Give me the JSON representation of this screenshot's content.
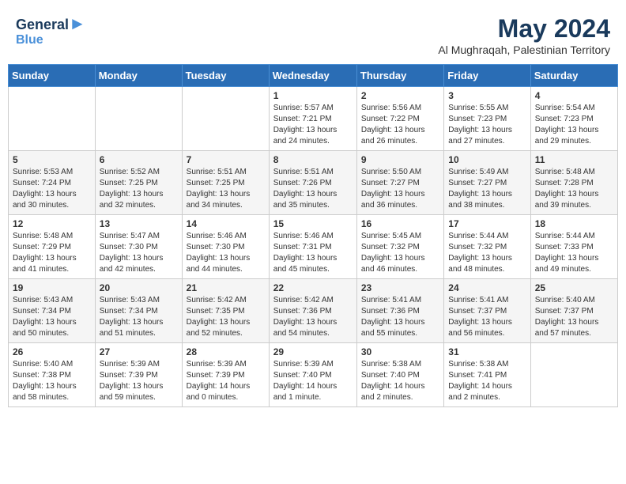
{
  "header": {
    "logo_line1": "General",
    "logo_line2": "Blue",
    "month": "May 2024",
    "location": "Al Mughraqah, Palestinian Territory"
  },
  "weekdays": [
    "Sunday",
    "Monday",
    "Tuesday",
    "Wednesday",
    "Thursday",
    "Friday",
    "Saturday"
  ],
  "weeks": [
    [
      {
        "day": "",
        "info": ""
      },
      {
        "day": "",
        "info": ""
      },
      {
        "day": "",
        "info": ""
      },
      {
        "day": "1",
        "info": "Sunrise: 5:57 AM\nSunset: 7:21 PM\nDaylight: 13 hours\nand 24 minutes."
      },
      {
        "day": "2",
        "info": "Sunrise: 5:56 AM\nSunset: 7:22 PM\nDaylight: 13 hours\nand 26 minutes."
      },
      {
        "day": "3",
        "info": "Sunrise: 5:55 AM\nSunset: 7:23 PM\nDaylight: 13 hours\nand 27 minutes."
      },
      {
        "day": "4",
        "info": "Sunrise: 5:54 AM\nSunset: 7:23 PM\nDaylight: 13 hours\nand 29 minutes."
      }
    ],
    [
      {
        "day": "5",
        "info": "Sunrise: 5:53 AM\nSunset: 7:24 PM\nDaylight: 13 hours\nand 30 minutes."
      },
      {
        "day": "6",
        "info": "Sunrise: 5:52 AM\nSunset: 7:25 PM\nDaylight: 13 hours\nand 32 minutes."
      },
      {
        "day": "7",
        "info": "Sunrise: 5:51 AM\nSunset: 7:25 PM\nDaylight: 13 hours\nand 34 minutes."
      },
      {
        "day": "8",
        "info": "Sunrise: 5:51 AM\nSunset: 7:26 PM\nDaylight: 13 hours\nand 35 minutes."
      },
      {
        "day": "9",
        "info": "Sunrise: 5:50 AM\nSunset: 7:27 PM\nDaylight: 13 hours\nand 36 minutes."
      },
      {
        "day": "10",
        "info": "Sunrise: 5:49 AM\nSunset: 7:27 PM\nDaylight: 13 hours\nand 38 minutes."
      },
      {
        "day": "11",
        "info": "Sunrise: 5:48 AM\nSunset: 7:28 PM\nDaylight: 13 hours\nand 39 minutes."
      }
    ],
    [
      {
        "day": "12",
        "info": "Sunrise: 5:48 AM\nSunset: 7:29 PM\nDaylight: 13 hours\nand 41 minutes."
      },
      {
        "day": "13",
        "info": "Sunrise: 5:47 AM\nSunset: 7:30 PM\nDaylight: 13 hours\nand 42 minutes."
      },
      {
        "day": "14",
        "info": "Sunrise: 5:46 AM\nSunset: 7:30 PM\nDaylight: 13 hours\nand 44 minutes."
      },
      {
        "day": "15",
        "info": "Sunrise: 5:46 AM\nSunset: 7:31 PM\nDaylight: 13 hours\nand 45 minutes."
      },
      {
        "day": "16",
        "info": "Sunrise: 5:45 AM\nSunset: 7:32 PM\nDaylight: 13 hours\nand 46 minutes."
      },
      {
        "day": "17",
        "info": "Sunrise: 5:44 AM\nSunset: 7:32 PM\nDaylight: 13 hours\nand 48 minutes."
      },
      {
        "day": "18",
        "info": "Sunrise: 5:44 AM\nSunset: 7:33 PM\nDaylight: 13 hours\nand 49 minutes."
      }
    ],
    [
      {
        "day": "19",
        "info": "Sunrise: 5:43 AM\nSunset: 7:34 PM\nDaylight: 13 hours\nand 50 minutes."
      },
      {
        "day": "20",
        "info": "Sunrise: 5:43 AM\nSunset: 7:34 PM\nDaylight: 13 hours\nand 51 minutes."
      },
      {
        "day": "21",
        "info": "Sunrise: 5:42 AM\nSunset: 7:35 PM\nDaylight: 13 hours\nand 52 minutes."
      },
      {
        "day": "22",
        "info": "Sunrise: 5:42 AM\nSunset: 7:36 PM\nDaylight: 13 hours\nand 54 minutes."
      },
      {
        "day": "23",
        "info": "Sunrise: 5:41 AM\nSunset: 7:36 PM\nDaylight: 13 hours\nand 55 minutes."
      },
      {
        "day": "24",
        "info": "Sunrise: 5:41 AM\nSunset: 7:37 PM\nDaylight: 13 hours\nand 56 minutes."
      },
      {
        "day": "25",
        "info": "Sunrise: 5:40 AM\nSunset: 7:37 PM\nDaylight: 13 hours\nand 57 minutes."
      }
    ],
    [
      {
        "day": "26",
        "info": "Sunrise: 5:40 AM\nSunset: 7:38 PM\nDaylight: 13 hours\nand 58 minutes."
      },
      {
        "day": "27",
        "info": "Sunrise: 5:39 AM\nSunset: 7:39 PM\nDaylight: 13 hours\nand 59 minutes."
      },
      {
        "day": "28",
        "info": "Sunrise: 5:39 AM\nSunset: 7:39 PM\nDaylight: 14 hours\nand 0 minutes."
      },
      {
        "day": "29",
        "info": "Sunrise: 5:39 AM\nSunset: 7:40 PM\nDaylight: 14 hours\nand 1 minute."
      },
      {
        "day": "30",
        "info": "Sunrise: 5:38 AM\nSunset: 7:40 PM\nDaylight: 14 hours\nand 2 minutes."
      },
      {
        "day": "31",
        "info": "Sunrise: 5:38 AM\nSunset: 7:41 PM\nDaylight: 14 hours\nand 2 minutes."
      },
      {
        "day": "",
        "info": ""
      }
    ]
  ]
}
